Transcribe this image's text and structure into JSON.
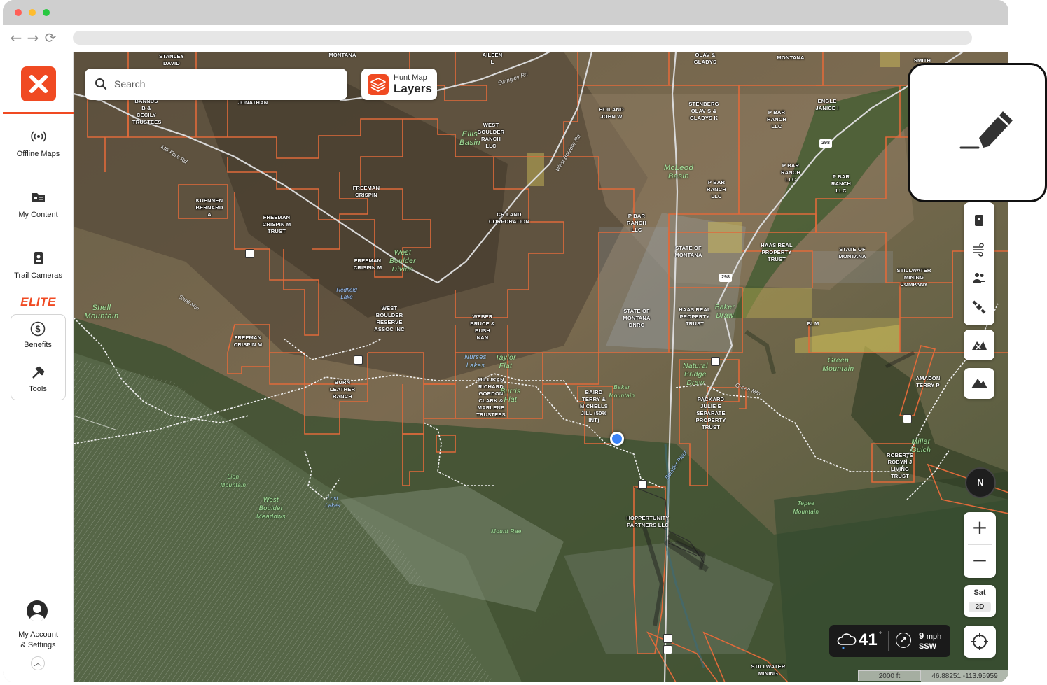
{
  "sidebar": {
    "items": [
      {
        "label": "Offline Maps",
        "icon": "offline-maps-icon"
      },
      {
        "label": "My Content",
        "icon": "my-content-icon"
      },
      {
        "label": "Trail Cameras",
        "icon": "trail-camera-icon"
      }
    ],
    "elite_badge": "ELITE",
    "elite_items": [
      {
        "label": "Benefits",
        "icon": "dollar-icon"
      },
      {
        "label": "Tools",
        "icon": "tools-icon"
      }
    ],
    "account_line1": "My Account",
    "account_line2": "& Settings"
  },
  "search": {
    "placeholder": "Search"
  },
  "layers_button": {
    "sub": "Hunt Map",
    "main": "Layers"
  },
  "compass": {
    "label": "N"
  },
  "zoom": {
    "in": "+",
    "out": "−"
  },
  "basemap": {
    "label": "Sat",
    "mode": "2D"
  },
  "weather": {
    "temp": "41",
    "temp_unit": "°",
    "wind_speed": "9",
    "wind_unit": "mph",
    "wind_dir": "SSW"
  },
  "scale": "2000 ft",
  "coords": "46.88251,-113.95959",
  "colors": {
    "brand": "#f04a22",
    "parcel_line": "#e06a3a",
    "blm": "#d4c35a",
    "state": "#8aa0b8"
  },
  "map": {
    "owners": [
      "STANLEY DAVID",
      "MONTANA",
      "AILEEN L",
      "OLAV & GLADYS",
      "MONTANA",
      "SMITH",
      "BANNUS B & CECILY TRUSTEES",
      "JONATHAN",
      "HOILAND JOHN W",
      "STENBERG OLAV S & GLADYS K",
      "P BAR RANCH LLC",
      "ENGLE JANICE I",
      "WEST BOULDER RANCH LLC",
      "P BAR RANCH LLC",
      "P BAR RANCH LLC",
      "P BAR RANCH LLC",
      "KUENNEN BERNARD A",
      "FREEMAN CRISPIN",
      "FREEMAN CRISPIN M TRUST",
      "CR LAND CORPORATION",
      "P BAR RANCH LLC",
      "STATE OF MONTANA",
      "HAAS REAL PROPERTY TRUST",
      "STATE OF MONTANA",
      "STILLWATER MINING COMPANY",
      "FREEMAN CRISPIN M",
      "WEST BOULDER RESERVE ASSOC INC",
      "WEBER BRUCE & BUSH NAN",
      "STATE OF MONTANA DNRC",
      "HAAS REAL PROPERTY TRUST",
      "BLM",
      "FREEMAN CRISPIN M",
      "BURN LEATHER RANCH",
      "MILLIKAN RICHARD GORDON CLARK & MARLENE TRUSTEES",
      "BAIRD TERRY & MICHELLS JILL (50% INT)",
      "PACKARD JULIE E SEPARATE PROPERTY TRUST",
      "AMADON TERRY P",
      "ROBERTS ROBYN J LIVING TRUST",
      "HOPPERTUNITY PARTNERS LLC",
      "STILLWATER MINING"
    ],
    "features": [
      "Ellis Basin",
      "McLeod Basin",
      "West Boulder Divide",
      "Shell Mountain",
      "Baker Draw",
      "Taylor Flat",
      "Nurses Lakes",
      "Burris Flat",
      "Natural Bridge Draw",
      "Green Mountain",
      "Baker Mountain",
      "Lion Mountain",
      "West Boulder Meadows",
      "Mount Rae",
      "Tepee Mountain",
      "Miller Gulch"
    ],
    "lakes": [
      "Redfield Lake",
      "Lost Lakes"
    ],
    "roads": [
      "Swingley Rd",
      "Mill Fork Rd",
      "West Boulder Rd",
      "Green Mtn",
      "Boulder River",
      "Shell Mtn"
    ],
    "highways": [
      "298",
      "298"
    ]
  }
}
